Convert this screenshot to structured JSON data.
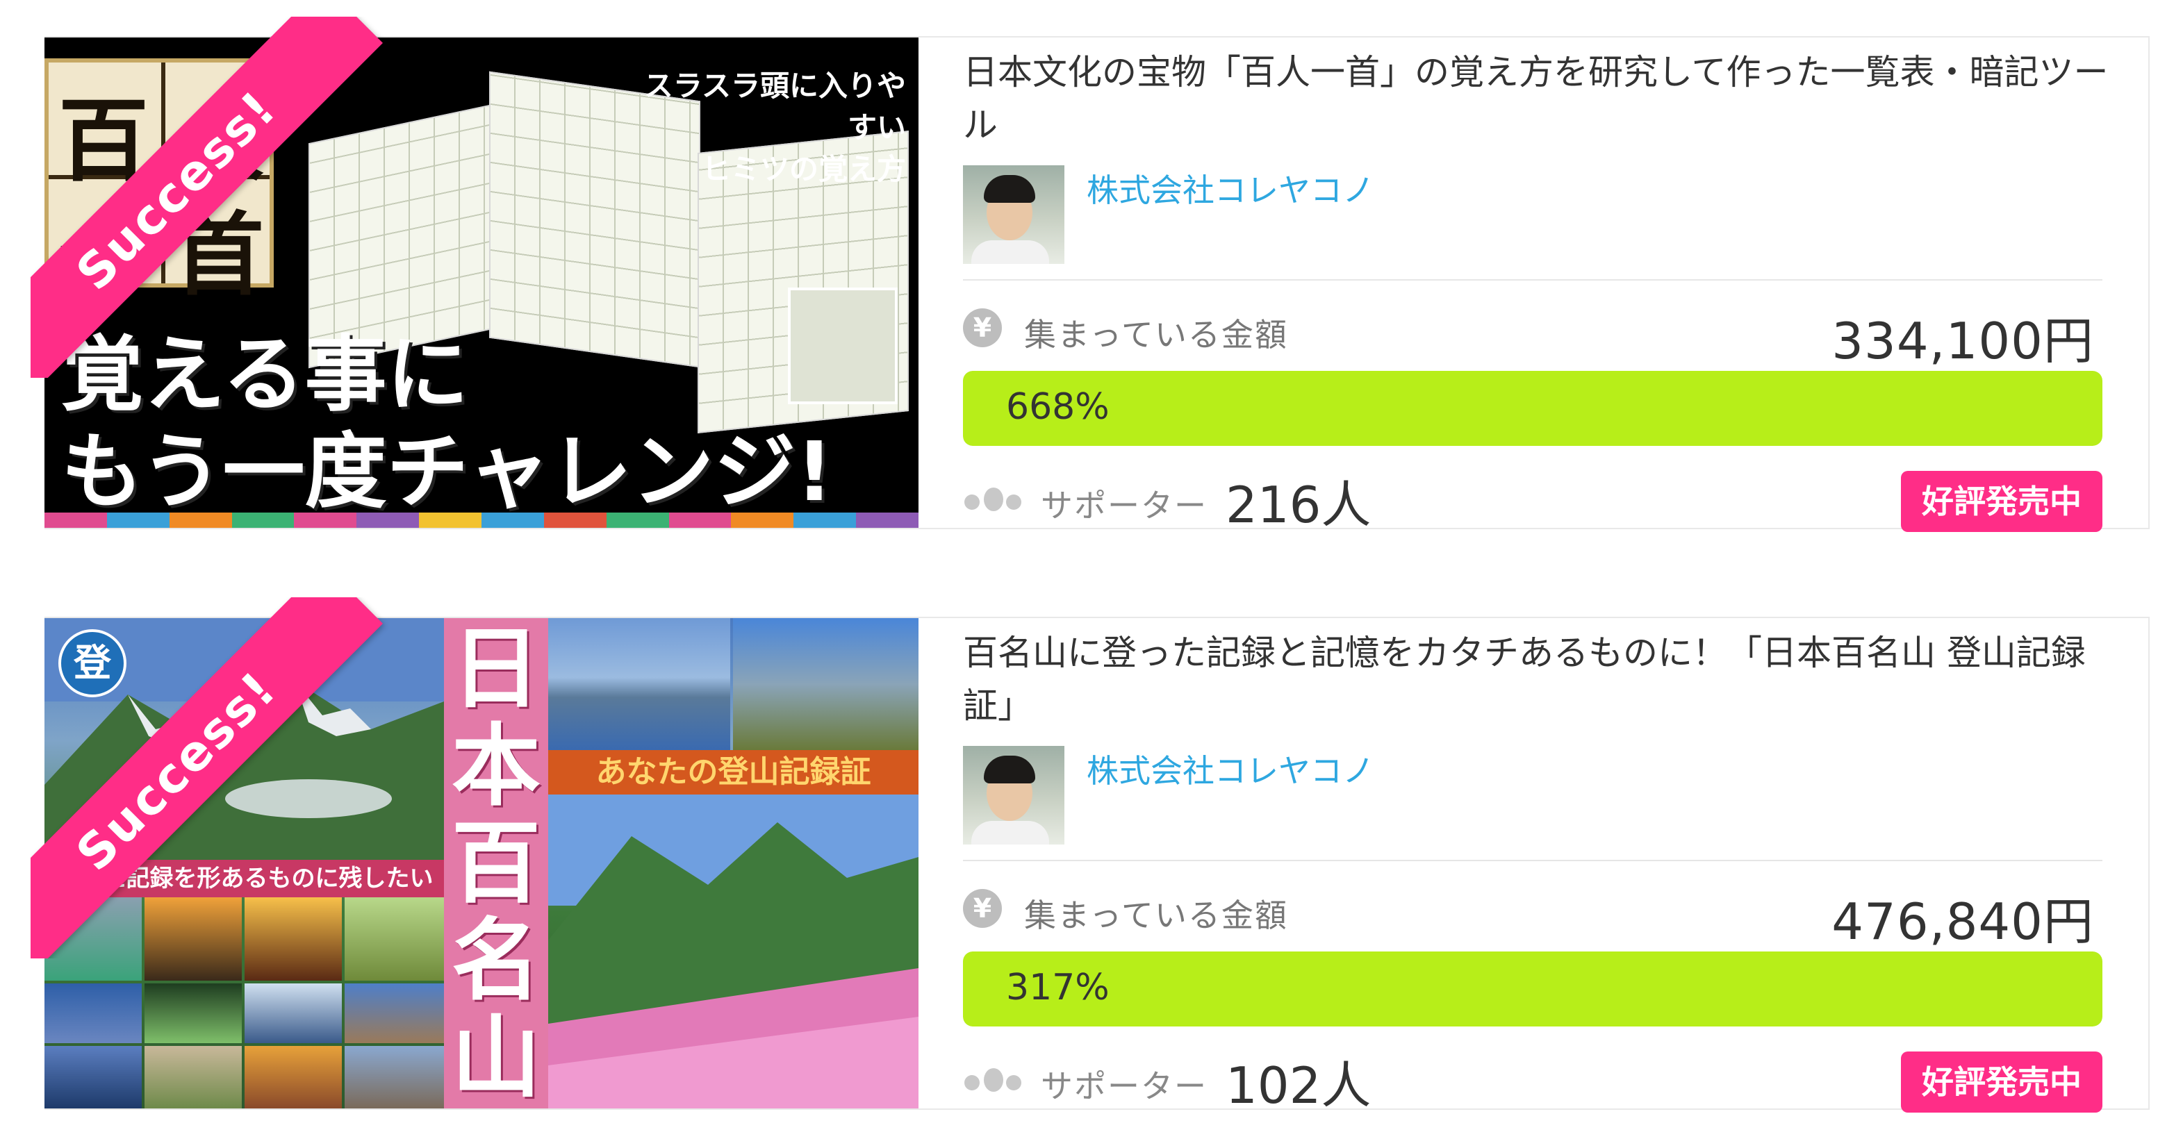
{
  "ribbon_label": "Success!",
  "colors": {
    "accent_pink": "#ff2d87",
    "progress_green": "#b7ee19",
    "owner_blue": "#2ea7e0"
  },
  "projects": [
    {
      "title": "日本文化の宝物「百人一首」の覚え方を研究して作った一覧表・暗記ツール",
      "owner": "株式会社コレヤコノ",
      "raised_label": "集まっている金額",
      "raised_amount": "334,100円",
      "progress_text": "668%",
      "progress_percent": 668,
      "supporters_label": "サポーター",
      "supporters_count": "216人",
      "status_badge": "好評発売中",
      "image": {
        "kanji": [
          "百",
          "人",
          "一",
          "首"
        ],
        "catch_line1": "スラスラ頭に入りやすい",
        "catch_line2": "ヒミツの覚え方",
        "headline_line1": "覚える事に",
        "headline_line2": "もう一度チャレンジ!"
      }
    },
    {
      "title": "百名山に登った記録と記憶をカタチあるものに！「日本百名山 登山記録証」",
      "owner": "株式会社コレヤコノ",
      "raised_label": "集まっている金額",
      "raised_amount": "476,840円",
      "progress_text": "317%",
      "progress_percent": 317,
      "supporters_label": "サポーター",
      "supporters_count": "102人",
      "status_badge": "好評発売中",
      "image": {
        "corner_kanji": "登",
        "vertical_title": [
          "日",
          "本",
          "百",
          "名",
          "山"
        ],
        "band_text": "あなたの登山記録証",
        "strip_text": "登った記録を形あるものに残したい"
      }
    }
  ]
}
